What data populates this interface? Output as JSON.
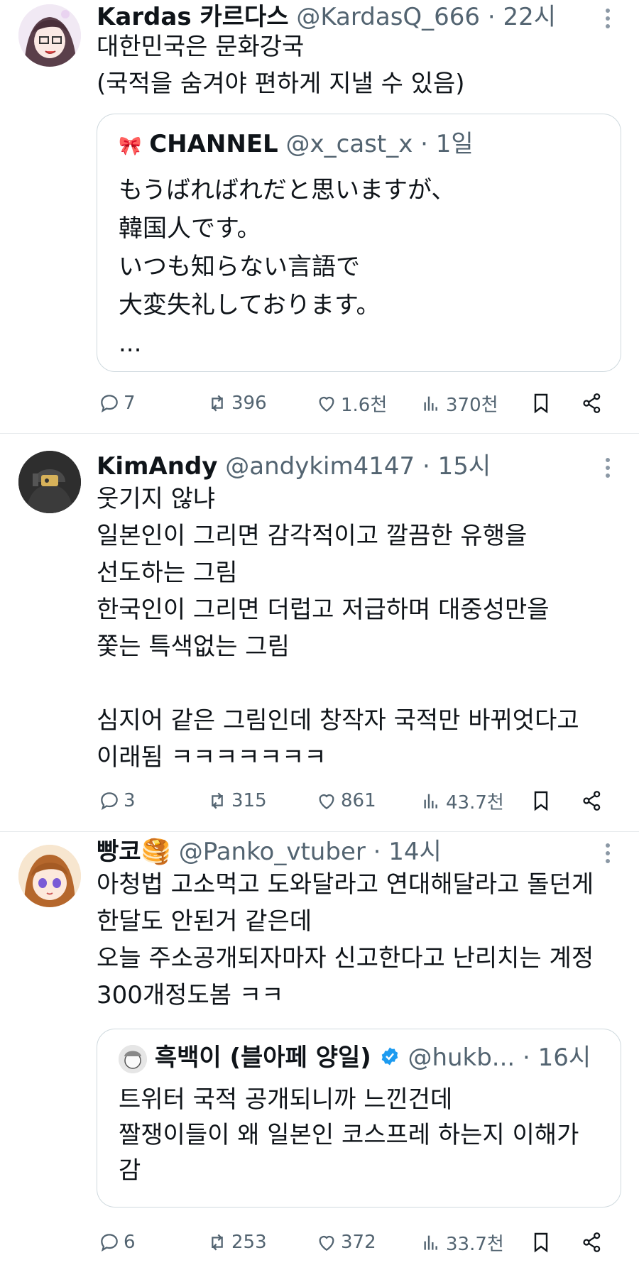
{
  "tweets": [
    {
      "name": "Kardas 카르다스",
      "handle": "@KardasQ_666",
      "time": "22시",
      "lines": [
        "대한민국은 문화강국",
        "(국적을 숨겨야 편하게 지낼 수 있음)"
      ],
      "quote": {
        "icon": "🎀",
        "name": "CHANNEL",
        "handle": "@x_cast_x",
        "time": "1일",
        "lines": [
          "もうばればれだと思いますが、",
          "韓国人です。",
          "いつも知らない言語で",
          "大変失礼しております。",
          "..."
        ]
      },
      "stats": {
        "replies": "7",
        "retweets": "396",
        "likes": "1.6천",
        "views": "370천"
      }
    },
    {
      "name": "KimAndy",
      "handle": "@andykim4147",
      "time": "15시",
      "lines": [
        "웃기지 않냐",
        "일본인이 그리면 감각적이고 깔끔한 유행을",
        "선도하는 그림",
        "한국인이 그리면 더럽고 저급하며 대중성만을",
        "쫓는 특색없는 그림",
        "",
        "심지어 같은 그림인데 창작자 국적만 바뀌엇다고",
        "이래됨 ㅋㅋㅋㅋㅋㅋㅋ"
      ],
      "stats": {
        "replies": "3",
        "retweets": "315",
        "likes": "861",
        "views": "43.7천"
      }
    },
    {
      "name": "빵코",
      "name_emoji": "🥞",
      "handle": "@Panko_vtuber",
      "time": "14시",
      "lines": [
        "아청법 고소먹고 도와달라고 연대해달라고 돌던게",
        "한달도 안된거 같은데",
        "오늘 주소공개되자마자 신고한다고 난리치는 계정",
        "300개정도봄 ㅋㅋ"
      ],
      "quote": {
        "name": "흑백이 (블아페 양일)",
        "handle": "@hukb...",
        "time": "16시",
        "lines": [
          "트위터 국적 공개되니까 느낀건데",
          "짤쟁이들이 왜 일본인 코스프레 하는지 이해가",
          "감"
        ]
      },
      "stats": {
        "replies": "6",
        "retweets": "253",
        "likes": "372",
        "views": "33.7천"
      }
    }
  ],
  "colors": {
    "text": "#0f1419",
    "muted": "#536471",
    "border": "#cfd9de",
    "verified": "#1d9bf0"
  }
}
